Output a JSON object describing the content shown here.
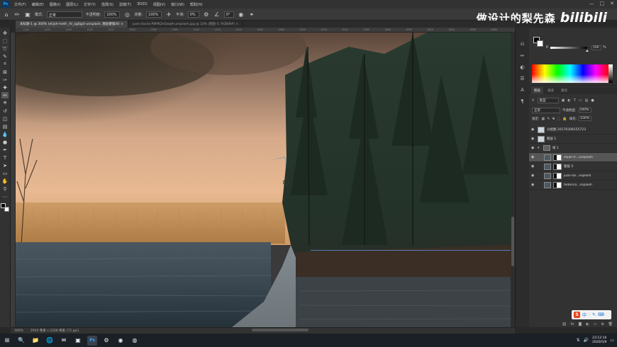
{
  "menubar": {
    "logo": "Ps",
    "items": [
      "文件(F)",
      "编辑(E)",
      "图像(I)",
      "图层(L)",
      "文字(Y)",
      "选择(S)",
      "滤镜(T)",
      "3D(D)",
      "视图(V)",
      "窗口(W)",
      "帮助(H)"
    ],
    "window_controls": [
      "—",
      "□",
      "✕"
    ]
  },
  "options": {
    "mode_label": "模式:",
    "mode_value": "正常",
    "opacity_label": "不透明度:",
    "opacity_value": "100%",
    "flow_label": "流量:",
    "flow_value": "100%",
    "smoothing_label": "平滑:",
    "smoothing_value": "0%",
    "angle_value": "0°"
  },
  "watermark": {
    "text": "做设计的梨先森",
    "logo": "bilibili"
  },
  "tabs": [
    {
      "label": "未标题-1 @ 300% (elijah-hiett-_IV_ogSqjU-unsplash, 图层蒙版/8) ×",
      "active": true
    },
    {
      "label": "juan-davila-P8PlK2nGwqA-unsplash.jpg @ 33% (图层 0, RGB/8#) ×",
      "active": false
    }
  ],
  "ruler_ticks": [
    "1240",
    "1260",
    "1280",
    "1300",
    "1320",
    "1340",
    "1360",
    "1380",
    "1400",
    "1420",
    "1440",
    "1460",
    "1480",
    "1500",
    "1520",
    "1540",
    "1560",
    "1580",
    "1600",
    "1620",
    "1640",
    "1660",
    "1680"
  ],
  "tools": [
    {
      "name": "move-tool-icon",
      "glyph": "✥"
    },
    {
      "name": "marquee-tool-icon",
      "glyph": "⬚"
    },
    {
      "name": "lasso-tool-icon",
      "glyph": "➰"
    },
    {
      "name": "quick-select-tool-icon",
      "glyph": "✎"
    },
    {
      "name": "crop-tool-icon",
      "glyph": "⌗"
    },
    {
      "name": "frame-tool-icon",
      "glyph": "⊠"
    },
    {
      "name": "eyedropper-tool-icon",
      "glyph": "✑"
    },
    {
      "name": "healing-brush-tool-icon",
      "glyph": "✚"
    },
    {
      "name": "brush-tool-icon",
      "glyph": "✏"
    },
    {
      "name": "clone-stamp-tool-icon",
      "glyph": "⎈"
    },
    {
      "name": "history-brush-tool-icon",
      "glyph": "↺"
    },
    {
      "name": "eraser-tool-icon",
      "glyph": "◫"
    },
    {
      "name": "gradient-tool-icon",
      "glyph": "▤"
    },
    {
      "name": "blur-tool-icon",
      "glyph": "💧"
    },
    {
      "name": "dodge-tool-icon",
      "glyph": "●"
    },
    {
      "name": "pen-tool-icon",
      "glyph": "✒"
    },
    {
      "name": "type-tool-icon",
      "glyph": "T"
    },
    {
      "name": "path-select-tool-icon",
      "glyph": "➤"
    },
    {
      "name": "shape-tool-icon",
      "glyph": "▭"
    },
    {
      "name": "hand-tool-icon",
      "glyph": "✋"
    },
    {
      "name": "zoom-tool-icon",
      "glyph": "⚲"
    },
    {
      "name": "more-tools-icon",
      "glyph": "⋯"
    }
  ],
  "status": {
    "zoom": "300%",
    "doc_size": "2944 像素 x 2208 像素 (72 ppi)"
  },
  "color_panel": {
    "channel_label": "K",
    "value": "100",
    "unit": "%"
  },
  "layers_panel": {
    "tabs": [
      "图层",
      "通道",
      "路径"
    ],
    "kind_value": "类型",
    "blend_value": "正常",
    "opacity_label": "不透明度:",
    "opacity_value": "100%",
    "lock_label": "锁定:",
    "fill_label": "填充:",
    "fill_value": "100%",
    "layers": [
      {
        "name": "分组图 20170308155723",
        "kind": "layer",
        "indent": false,
        "selected": false
      },
      {
        "name": "图层 1",
        "kind": "layer",
        "indent": false,
        "selected": false
      },
      {
        "name": "组 1",
        "kind": "group",
        "indent": false,
        "selected": false
      },
      {
        "name": "elijah-h...unsplash",
        "kind": "masked",
        "indent": true,
        "selected": true
      },
      {
        "name": "图层 3",
        "kind": "masked",
        "indent": true,
        "selected": false
      },
      {
        "name": "juan-da...nsplash",
        "kind": "masked",
        "indent": true,
        "selected": false
      },
      {
        "name": "federico...nsplash",
        "kind": "masked",
        "indent": true,
        "selected": false
      }
    ]
  },
  "sogou": {
    "logo": "S",
    "items": [
      "中",
      "·",
      "✎",
      "⌨"
    ]
  },
  "taskbar": {
    "apps": [
      "⊞",
      "🔍",
      "📁",
      "🌐",
      "✉",
      "▣",
      "Ps",
      "⚙",
      "◉",
      "◍"
    ],
    "clock_time": "23:12:10",
    "clock_date": "2020/5/9"
  }
}
